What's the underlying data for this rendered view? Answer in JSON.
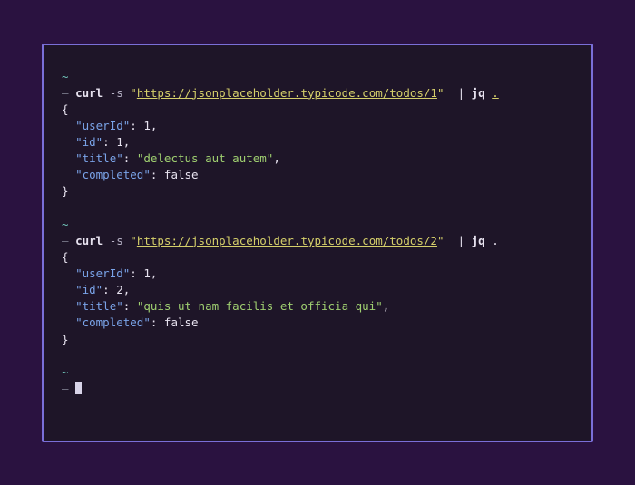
{
  "blocks": [
    {
      "prompt": {
        "tilde": "~",
        "dash": "—",
        "cmd": "curl",
        "flag": "-s",
        "q1": "\"",
        "url": "https://jsonplaceholder.typicode.com/todos/1",
        "q2": "\"",
        "pipe": "|",
        "prog": "jq",
        "arg": ".",
        "dotUnderlined": true
      },
      "json": {
        "open": "{",
        "rows": [
          {
            "key": "\"userId\"",
            "colon": ":",
            "val": "1",
            "valType": "num",
            "comma": ","
          },
          {
            "key": "\"id\"",
            "colon": ":",
            "val": "1",
            "valType": "num",
            "comma": ","
          },
          {
            "key": "\"title\"",
            "colon": ":",
            "val": "\"delectus aut autem\"",
            "valType": "jstr",
            "comma": ","
          },
          {
            "key": "\"completed\"",
            "colon": ":",
            "val": "false",
            "valType": "bool",
            "comma": ""
          }
        ],
        "close": "}"
      }
    },
    {
      "prompt": {
        "tilde": "~",
        "dash": "—",
        "cmd": "curl",
        "flag": "-s",
        "q1": "\"",
        "url": "https://jsonplaceholder.typicode.com/todos/2",
        "q2": "\"",
        "pipe": "|",
        "prog": "jq",
        "arg": ".",
        "dotUnderlined": false
      },
      "json": {
        "open": "{",
        "rows": [
          {
            "key": "\"userId\"",
            "colon": ":",
            "val": "1",
            "valType": "num",
            "comma": ","
          },
          {
            "key": "\"id\"",
            "colon": ":",
            "val": "2",
            "valType": "num",
            "comma": ","
          },
          {
            "key": "\"title\"",
            "colon": ":",
            "val": "\"quis ut nam facilis et officia qui\"",
            "valType": "jstr",
            "comma": ","
          },
          {
            "key": "\"completed\"",
            "colon": ":",
            "val": "false",
            "valType": "bool",
            "comma": ""
          }
        ],
        "close": "}"
      }
    }
  ],
  "finalPrompt": {
    "tilde": "~",
    "dash": "—"
  }
}
